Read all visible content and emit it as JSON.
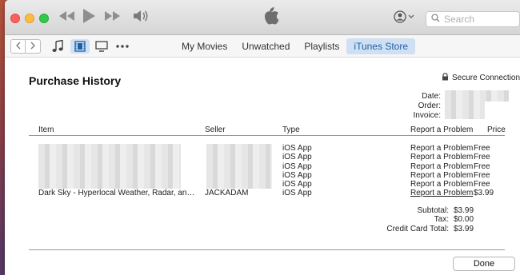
{
  "titlebar": {
    "search_placeholder": "Search",
    "icons": [
      "rewind-icon",
      "play-icon",
      "fast-forward-icon",
      "volume-icon",
      "apple-logo-icon",
      "account-icon",
      "search-icon"
    ]
  },
  "toolbar": {
    "media_icons": [
      "music-note-icon",
      "movie-icon",
      "tv-icon",
      "more-icon"
    ],
    "tabs": [
      {
        "label": "My Movies",
        "active": false
      },
      {
        "label": "Unwatched",
        "active": false
      },
      {
        "label": "Playlists",
        "active": false
      },
      {
        "label": "iTunes Store",
        "active": true
      }
    ]
  },
  "page": {
    "title": "Purchase History",
    "secure": "Secure Connection",
    "meta_labels": {
      "date": "Date:",
      "order": "Order:",
      "invoice": "Invoice:"
    }
  },
  "table": {
    "headers": {
      "item": "Item",
      "seller": "Seller",
      "type": "Type",
      "report": "Report a Problem",
      "price": "Price"
    },
    "rows": [
      {
        "item": "",
        "seller": "",
        "type": "iOS App",
        "report": "Report a Problem",
        "price": "Free",
        "report_link": false
      },
      {
        "item": "",
        "seller": "",
        "type": "iOS App",
        "report": "Report a Problem",
        "price": "Free",
        "report_link": false
      },
      {
        "item": "",
        "seller": "",
        "type": "iOS App",
        "report": "Report a Problem",
        "price": "Free",
        "report_link": false
      },
      {
        "item": "",
        "seller": "",
        "type": "iOS App",
        "report": "Report a Problem",
        "price": "Free",
        "report_link": false
      },
      {
        "item": "",
        "seller": "",
        "type": "iOS App",
        "report": "Report a Problem",
        "price": "Free",
        "report_link": false
      },
      {
        "item": "Dark Sky - Hyperlocal Weather, Radar, and S...",
        "seller": "JACKADAM",
        "type": "iOS App",
        "report": "Report a Problem",
        "price": "$3.99",
        "report_link": true
      }
    ]
  },
  "totals": {
    "subtotal_label": "Subtotal:",
    "subtotal": "$3.99",
    "tax_label": "Tax:",
    "tax": "$0.00",
    "cc_label": "Credit Card Total:",
    "cc": "$3.99"
  },
  "done_label": "Done",
  "colors": {
    "accent_tab_bg": "#cfe0f2",
    "accent_tab_text": "#1e5fa8"
  }
}
